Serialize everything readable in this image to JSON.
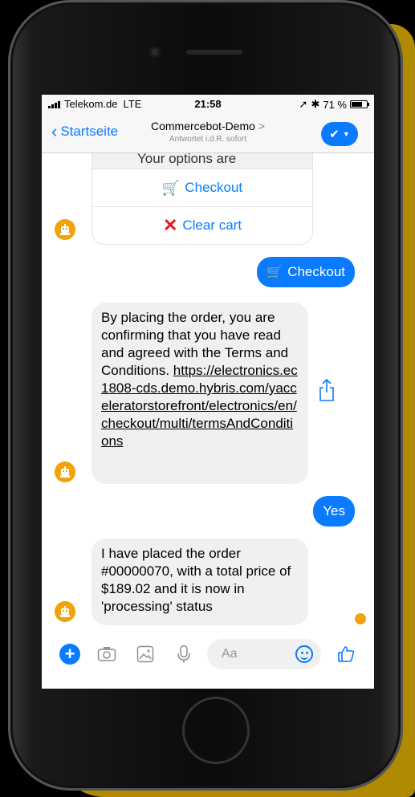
{
  "status_bar": {
    "carrier": "Telekom.de",
    "network": "LTE",
    "time": "21:58",
    "battery": "71 %"
  },
  "nav": {
    "back_label": "Startseite",
    "title": "Commercebot-Demo",
    "title_chevron": ">",
    "subtitle": "Antwortet i.d.R. sofort"
  },
  "messages": {
    "options_header": "Your options are",
    "option_checkout": "Checkout",
    "option_clear_cart": "Clear cart",
    "user_checkout": "Checkout",
    "terms_text": "By placing the order, you are confirming that you have read and agreed with the Terms and Conditions. ",
    "terms_link": "https://electronics.ec1808-cds.demo.hybris.com/yacceleratorstorefront/electronics/en/checkout/multi/termsAndConditions",
    "user_yes": "Yes",
    "order_text": "I have placed the order #00000070, with a total price of $189.02 and it is now in 'processing' status"
  },
  "composer": {
    "placeholder": "Aa"
  },
  "colors": {
    "accent": "#0a7aff",
    "bot_avatar": "#f0a30a",
    "incoming_bubble": "#f1f0f0",
    "clear_icon": "#e8141e"
  },
  "icons": [
    "signal-bars-icon",
    "location-arrow-icon",
    "bluetooth-icon",
    "battery-icon",
    "back-chevron-icon",
    "checkmark-icon",
    "dropdown-caret-icon",
    "shopping-cart-icon",
    "red-x-icon",
    "robot-icon",
    "share-icon",
    "plus-icon",
    "camera-icon",
    "gallery-icon",
    "microphone-icon",
    "emoji-icon",
    "thumbs-up-icon"
  ]
}
